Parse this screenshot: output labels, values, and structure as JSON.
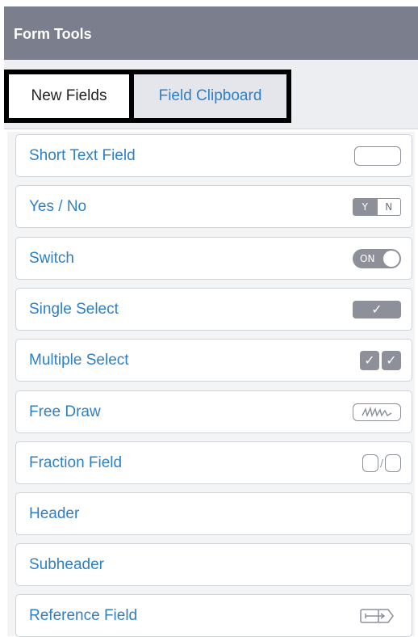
{
  "header": {
    "title": "Form Tools"
  },
  "tabs": [
    {
      "label": "New Fields",
      "active": true
    },
    {
      "label": "Field Clipboard",
      "active": false
    }
  ],
  "fields": [
    {
      "label": "Short Text Field",
      "icon": "text-box-icon"
    },
    {
      "label": "Yes / No",
      "icon": "yes-no-icon",
      "icon_text": [
        "Y",
        "N"
      ]
    },
    {
      "label": "Switch",
      "icon": "switch-icon",
      "icon_text": "ON"
    },
    {
      "label": "Single Select",
      "icon": "single-select-icon"
    },
    {
      "label": "Multiple Select",
      "icon": "multiple-select-icon"
    },
    {
      "label": "Free Draw",
      "icon": "free-draw-icon"
    },
    {
      "label": "Fraction Field",
      "icon": "fraction-icon",
      "icon_text": "/"
    },
    {
      "label": "Header",
      "icon": ""
    },
    {
      "label": "Subheader",
      "icon": ""
    },
    {
      "label": "Reference Field",
      "icon": "reference-icon"
    }
  ],
  "colors": {
    "header_bg": "#7b7f8d",
    "link_blue": "#2f7fc5",
    "icon_gray": "#8d9099"
  }
}
